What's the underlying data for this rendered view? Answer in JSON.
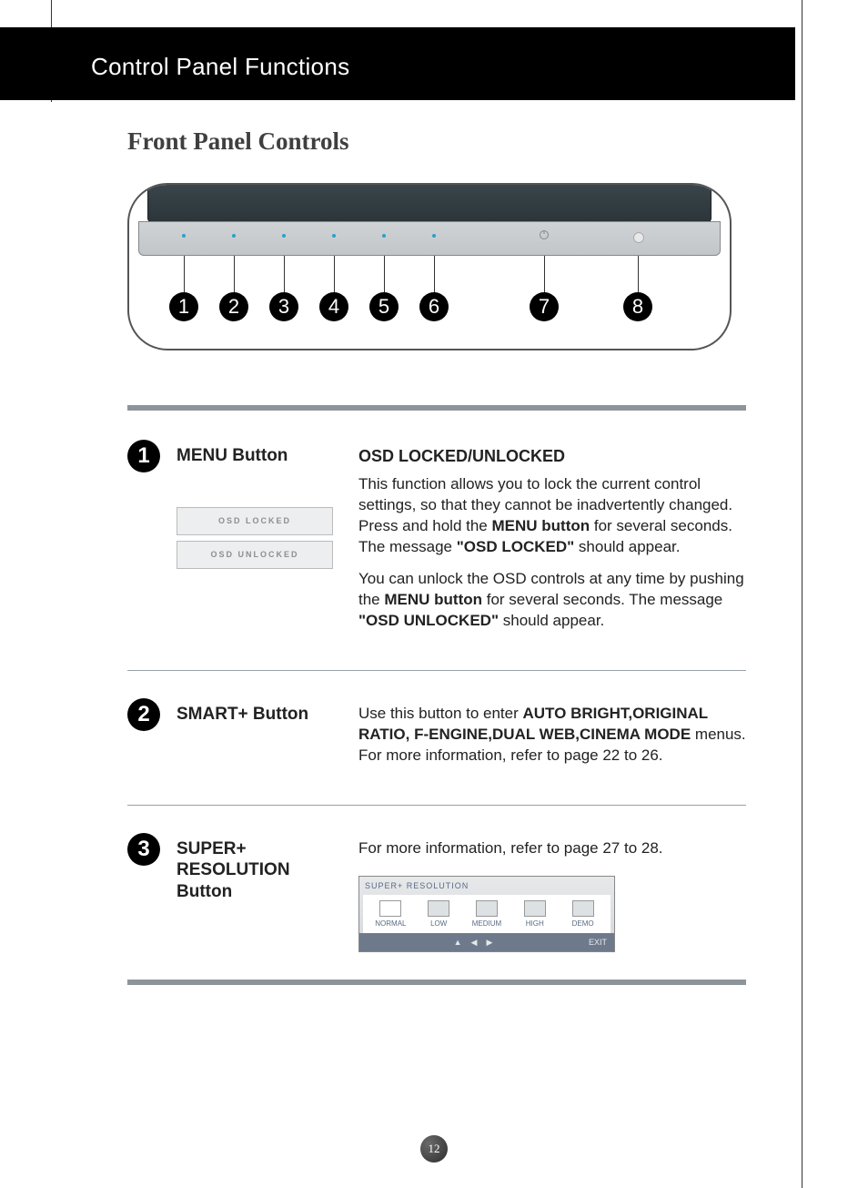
{
  "header": {
    "title": "Control Panel Functions"
  },
  "section_title": "Front Panel Controls",
  "diagram": {
    "callouts": [
      "1",
      "2",
      "3",
      "4",
      "5",
      "6",
      "7",
      "8"
    ]
  },
  "items": [
    {
      "num": "1",
      "label": "MENU Button",
      "osd_boxes": [
        "OSD LOCKED",
        "OSD UNLOCKED"
      ],
      "heading": "OSD LOCKED/UNLOCKED",
      "para1_a": "This function allows you to lock the current control settings, so that they cannot be inadvertently changed. Press and hold the ",
      "para1_bold1": "MENU button",
      "para1_b": " for several seconds. The message ",
      "para1_bold2": "\"OSD LOCKED\"",
      "para1_c": " should appear.",
      "para2_a": "You can unlock the OSD controls at any time by pushing the ",
      "para2_bold1": "MENU button",
      "para2_b": " for several seconds. The message ",
      "para2_bold2": "\"OSD UNLOCKED\"",
      "para2_c": " should appear."
    },
    {
      "num": "2",
      "label": "SMART+ Button",
      "desc_a": "Use this button to enter ",
      "desc_bold": "AUTO BRIGHT,ORIGINAL RATIO, F-ENGINE,DUAL WEB,CINEMA MODE",
      "desc_b": " menus.",
      "desc_line2": "For more information, refer to page 22 to 26."
    },
    {
      "num": "3",
      "label_line1": "SUPER+",
      "label_line2": "RESOLUTION",
      "label_line3": "Button",
      "desc": "For more information, refer to page 27 to 28.",
      "sr_panel": {
        "title": "SUPER+ RESOLUTION",
        "options": [
          "NORMAL",
          "LOW",
          "MEDIUM",
          "HIGH",
          "DEMO"
        ],
        "exit": "EXIT"
      }
    }
  ],
  "page_number": "12"
}
